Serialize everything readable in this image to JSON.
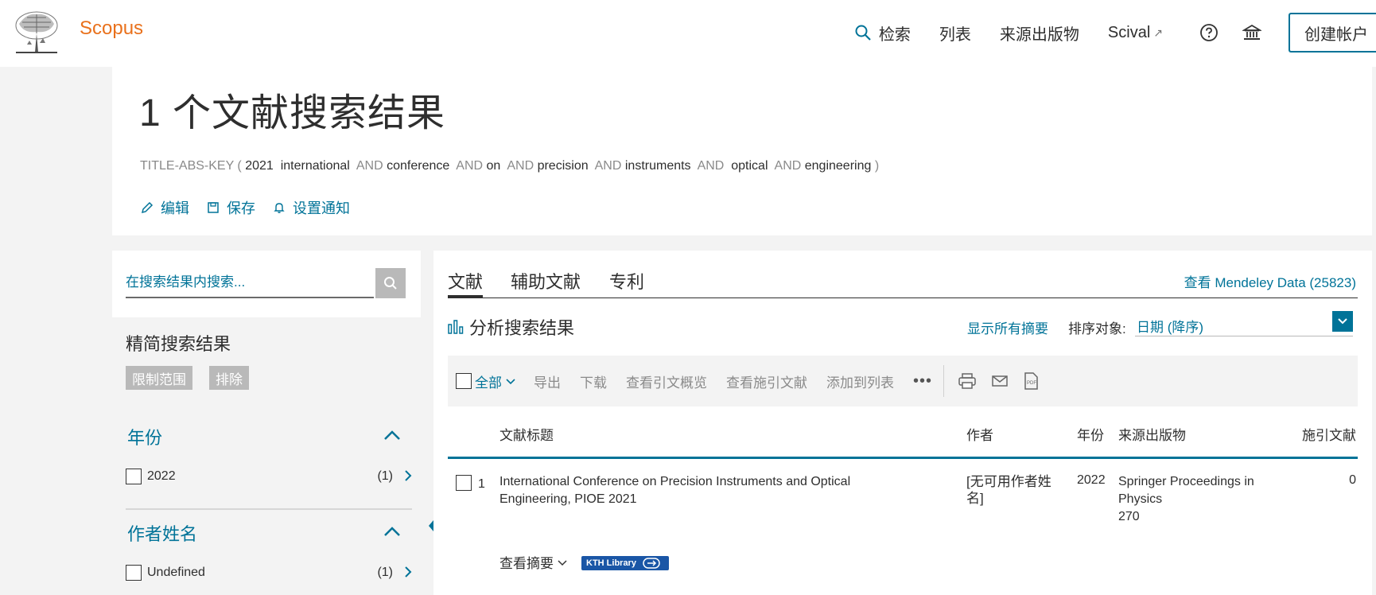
{
  "header": {
    "brand": "Scopus",
    "nav": {
      "search": "检索",
      "lists": "列表",
      "sources": "来源出版物",
      "scival": "Scival",
      "scival_ext": "↗"
    },
    "create_account": "创建帐户"
  },
  "query": {
    "title": "1 个文献搜索结果",
    "field": "TITLE-ABS-KEY",
    "terms": [
      "2021",
      "international",
      "conference",
      "on",
      "precision",
      "instruments",
      "optical",
      "engineering"
    ],
    "operator": "AND",
    "actions": {
      "edit": "编辑",
      "save": "保存",
      "alert": "设置通知"
    }
  },
  "sidebar": {
    "search_placeholder": "在搜索结果内搜索...",
    "refine_title": "精简搜索结果",
    "limit_to": "限制范围",
    "exclude": "排除",
    "facets": [
      {
        "title": "年份",
        "items": [
          {
            "label": "2022",
            "count": "(1)"
          }
        ]
      },
      {
        "title": "作者姓名",
        "items": [
          {
            "label": "Undefined",
            "count": "(1)"
          }
        ]
      }
    ]
  },
  "main": {
    "tabs": [
      "文献",
      "辅助文献",
      "专利"
    ],
    "mendeley": "查看 Mendeley Data (25823)",
    "analyze": "分析搜索结果",
    "show_abstracts": "显示所有摘要",
    "sort_label": "排序对象:",
    "sort_value": "日期 (降序)",
    "toolbar": {
      "all": "全部",
      "export": "导出",
      "download": "下载",
      "citation_overview": "查看引文概览",
      "cited_by": "查看施引文献",
      "add_to_list": "添加到列表",
      "more": "•••"
    },
    "columns": {
      "title": "文献标题",
      "authors": "作者",
      "year": "年份",
      "source": "来源出版物",
      "cited": "施引文献"
    },
    "rows": [
      {
        "num": "1",
        "title": "International Conference on Precision Instruments and Optical Engineering, PIOE 2021",
        "authors": "[无可用作者姓名]",
        "year": "2022",
        "source": "Springer Proceedings in Physics",
        "volume": "270",
        "cited": "0",
        "view_abstract": "查看摘要",
        "library_link": "KTH Library"
      }
    ]
  }
}
